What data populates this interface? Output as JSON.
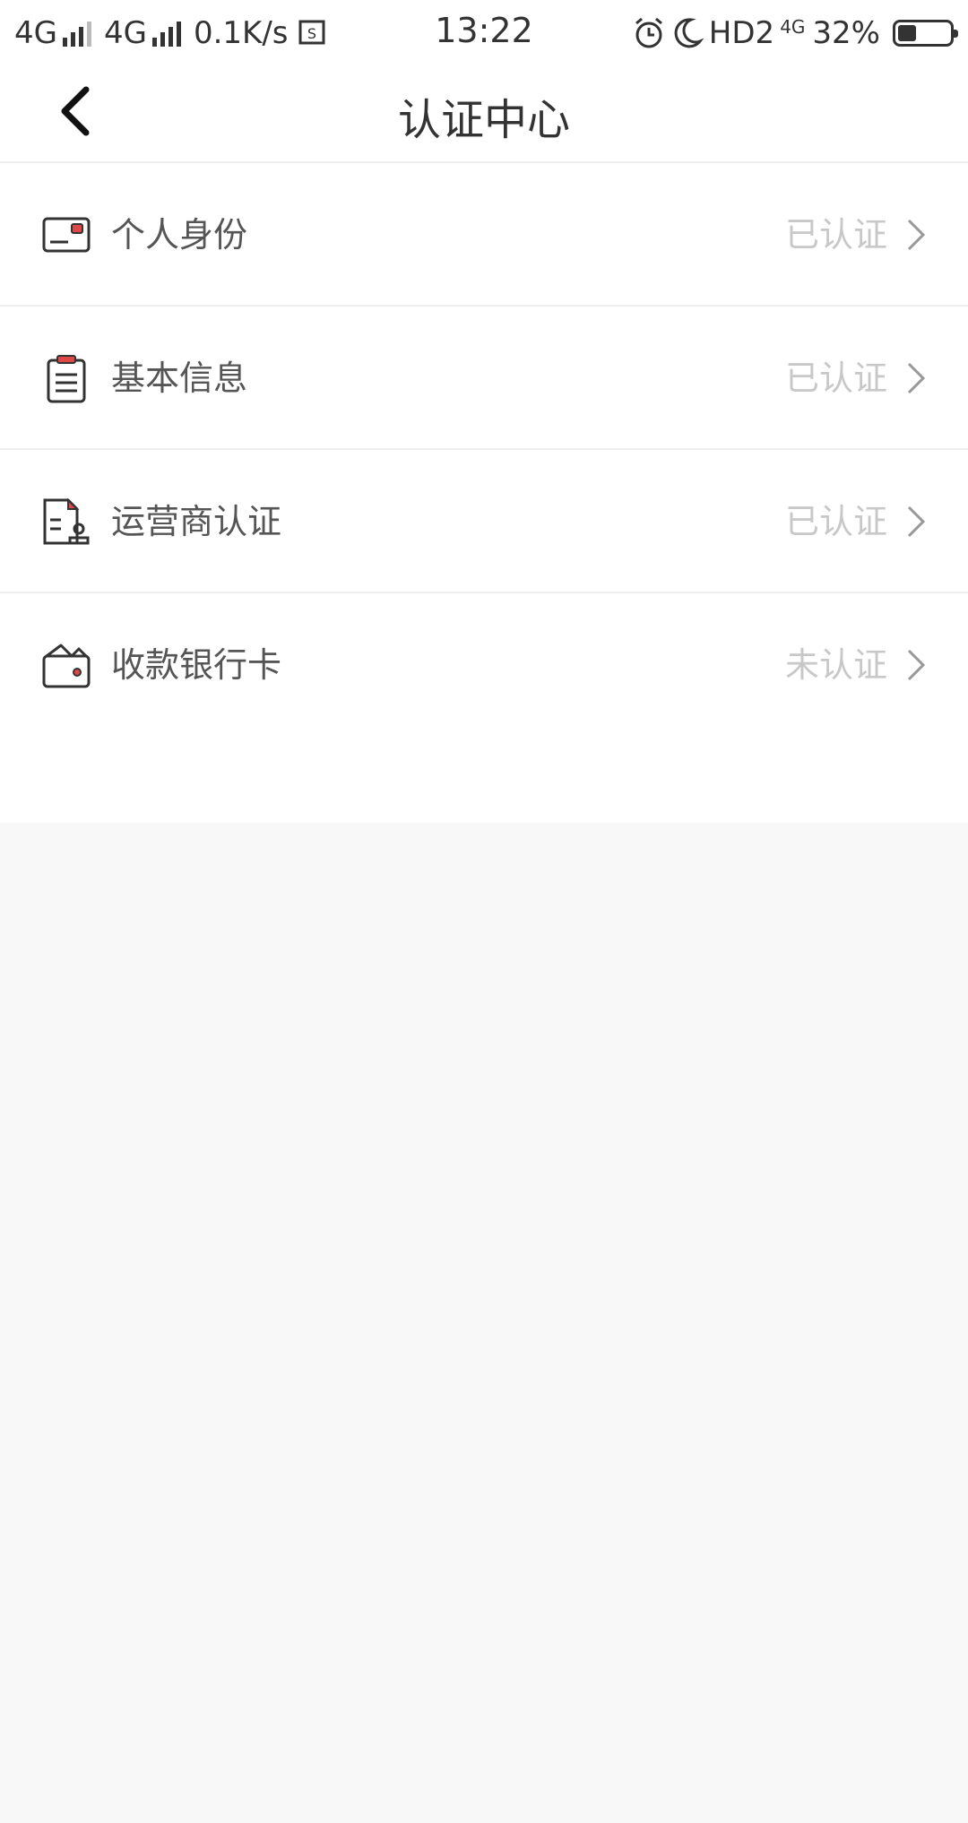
{
  "status_bar": {
    "left_text_1": "4G",
    "left_text_2": "4G",
    "net_speed": "0.1K/s",
    "time": "13:22",
    "hd_text": "HD2",
    "net_small": "4G",
    "battery_text": "32%",
    "battery_level": 0.32
  },
  "header": {
    "title": "认证中心"
  },
  "items": [
    {
      "label": "个人身份",
      "status": "已认证",
      "icon": "id-card-icon"
    },
    {
      "label": "基本信息",
      "status": "已认证",
      "icon": "clipboard-icon"
    },
    {
      "label": "运营商认证",
      "status": "已认证",
      "icon": "operator-doc-icon"
    },
    {
      "label": "收款银行卡",
      "status": "未认证",
      "icon": "wallet-icon"
    }
  ],
  "colors": {
    "accent": "#e04848",
    "text": "#333333",
    "muted": "#c8c8c8",
    "background": "#f8f8f8"
  }
}
